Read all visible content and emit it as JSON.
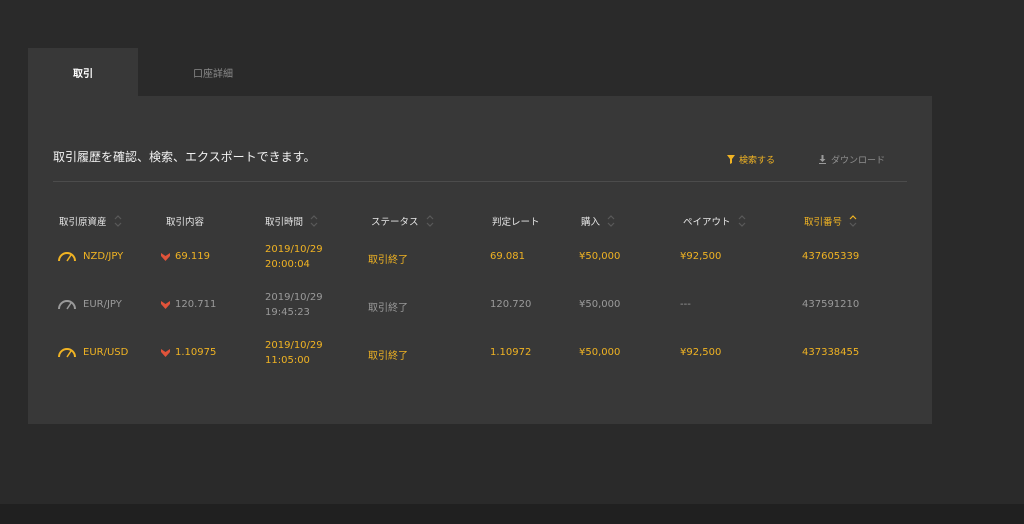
{
  "tabs": [
    {
      "label": "取引"
    },
    {
      "label": "口座詳細"
    }
  ],
  "description": "取引履歴を確認、検索、エクスポートできます。",
  "actions": {
    "search_label": "検索する",
    "download_label": "ダウンロード"
  },
  "columns": [
    "取引原資産",
    "取引内容",
    "取引時間",
    "ステータス",
    "判定レート",
    "購入",
    "ペイアウト",
    "取引番号"
  ],
  "rows": [
    {
      "asset": "NZD/JPY",
      "price": "69.119",
      "date": "2019/10/29",
      "time": "20:00:04",
      "status": "取引終了",
      "rate": "69.081",
      "purchase": "¥50,000",
      "payout": "¥92,500",
      "id": "437605339",
      "highlight": true
    },
    {
      "asset": "EUR/JPY",
      "price": "120.711",
      "date": "2019/10/29",
      "time": "19:45:23",
      "status": "取引終了",
      "rate": "120.720",
      "purchase": "¥50,000",
      "payout": "---",
      "id": "437591210",
      "highlight": false
    },
    {
      "asset": "EUR/USD",
      "price": "1.10975",
      "date": "2019/10/29",
      "time": "11:05:00",
      "status": "取引終了",
      "rate": "1.10972",
      "purchase": "¥50,000",
      "payout": "¥92,500",
      "id": "437338455",
      "highlight": true
    }
  ],
  "colors": {
    "accent": "#f0b323",
    "down_arrow": "#e0533a",
    "muted": "#9a9a9a"
  }
}
